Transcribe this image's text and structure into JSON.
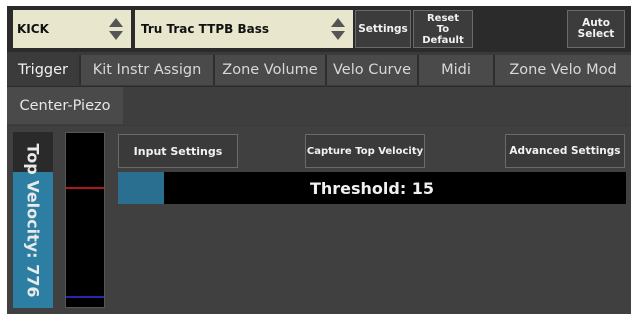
{
  "topbar": {
    "kit_select": "KICK",
    "instrument_select": "Tru Trac TTPB Bass",
    "settings_label": "Settings",
    "reset_label": "Reset\nTo\nDefault",
    "auto_select_label": "Auto\nSelect"
  },
  "tabs": [
    {
      "label": "Trigger",
      "active": true
    },
    {
      "label": "Kit Instr Assign",
      "active": false
    },
    {
      "label": "Zone Volume",
      "active": false
    },
    {
      "label": "Velo Curve",
      "active": false
    },
    {
      "label": "Midi",
      "active": false
    },
    {
      "label": "Zone Velo Mod",
      "active": false
    }
  ],
  "subtabs": [
    {
      "label": "Center-Piezo",
      "active": true
    }
  ],
  "velocity_panel": {
    "label": "Top Velocity: 776"
  },
  "buttons": {
    "input_settings": "Input Settings",
    "capture_top_velocity": "Capture Top Velocity",
    "advanced_settings": "Advanced Settings"
  },
  "threshold": {
    "label": "Threshold: 15",
    "value": 15,
    "fill_fraction": 0.09
  },
  "colors": {
    "select_bg": "#e8e6cc",
    "accent_blue": "#2c7fa3",
    "meter_red": "#b01818",
    "meter_blue": "#2626b0"
  }
}
